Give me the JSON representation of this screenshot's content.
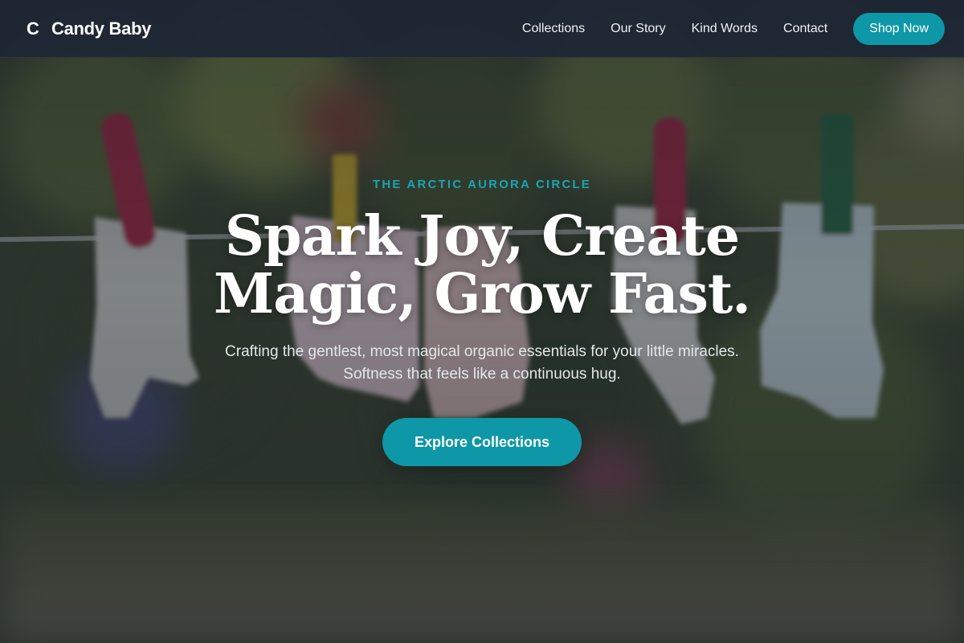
{
  "brand": {
    "mark": "C",
    "name": "Candy Baby"
  },
  "nav": {
    "links": [
      "Collections",
      "Our Story",
      "Kind Words",
      "Contact"
    ],
    "cta": "Shop Now"
  },
  "hero": {
    "eyebrow": "THE ARCTIC AURORA CIRCLE",
    "headline": "Spark Joy, Create Magic, Grow Fast.",
    "subhead": "Crafting the gentlest, most magical organic essentials for your little miracles. Softness that feels like a continuous hug.",
    "cta": "Explore Collections",
    "background_image": "baby-socks-on-clothesline-photo"
  },
  "colors": {
    "accent": "#0e97a6",
    "eyebrow": "#17a5b4",
    "navbar": "#1e2634"
  }
}
